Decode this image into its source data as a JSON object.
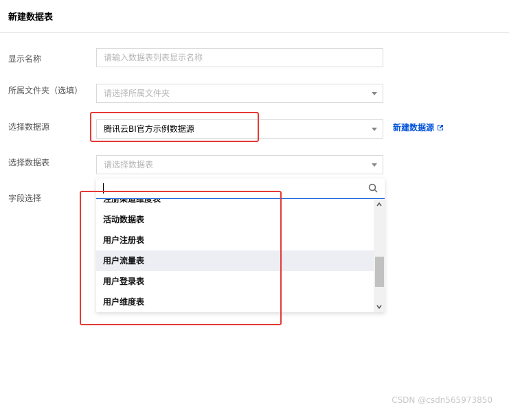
{
  "page": {
    "title": "新建数据表"
  },
  "form": {
    "display_name": {
      "label": "显示名称",
      "placeholder": "请输入数据表列表显示名称"
    },
    "folder": {
      "label": "所属文件夹（选填）",
      "placeholder": "请选择所属文件夹"
    },
    "datasource": {
      "label": "选择数据源",
      "value": "腾讯云BI官方示例数据源",
      "new_link": "新建数据源"
    },
    "datatable": {
      "label": "选择数据表",
      "placeholder": "请选择数据表"
    },
    "fields": {
      "label": "字段选择"
    }
  },
  "dropdown": {
    "search_value": "",
    "items": [
      {
        "label": "注册渠道维度表"
      },
      {
        "label": "活动数据表"
      },
      {
        "label": "用户注册表"
      },
      {
        "label": "用户流量表",
        "hovered": true
      },
      {
        "label": "用户登录表"
      },
      {
        "label": "用户维度表"
      }
    ]
  },
  "watermark": "CSDN @csdn565973850",
  "colors": {
    "accent": "#0052d9",
    "highlight": "#e53935",
    "hover_bg": "#eceef3"
  }
}
